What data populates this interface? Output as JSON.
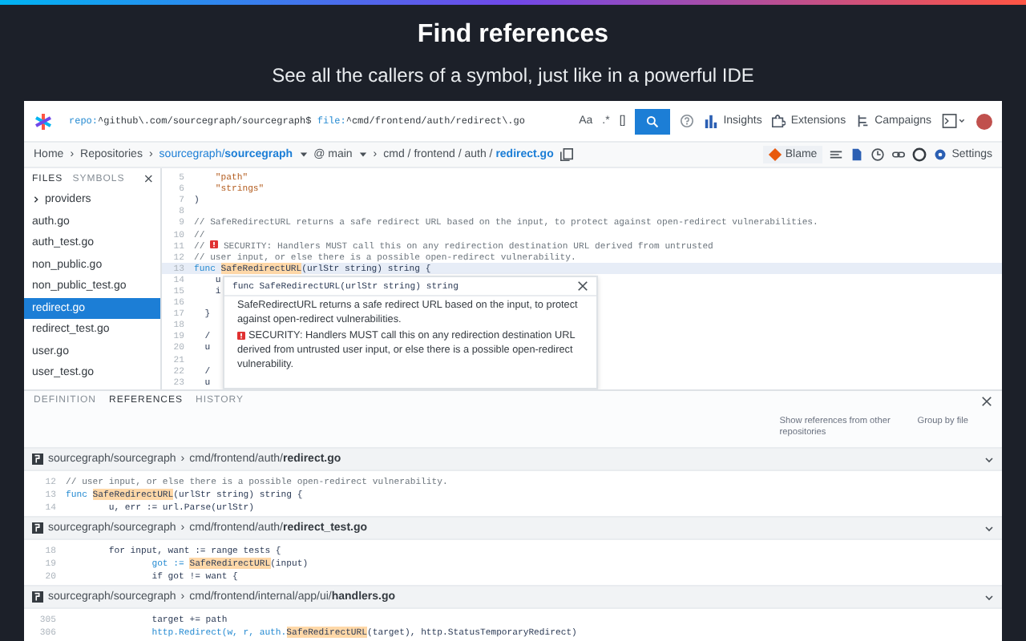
{
  "promo": {
    "title": "Find references",
    "subtitle": "See all the callers of a symbol, just like in a powerful IDE"
  },
  "toolbar": {
    "query": [
      {
        "kind": "filter",
        "text": "repo:"
      },
      {
        "kind": "value",
        "text": "^github\\.com/sourcegraph/sourcegraph$"
      },
      {
        "kind": "filter",
        "text": " file:"
      },
      {
        "kind": "value",
        "text": "^cmd/frontend/auth/redirect\\.go"
      }
    ],
    "toggles": [
      "Aa",
      ".*",
      "[]"
    ],
    "nav": [
      {
        "kind": "insights",
        "label": "Insights"
      },
      {
        "kind": "extensions",
        "label": "Extensions"
      },
      {
        "kind": "campaigns",
        "label": "Campaigns"
      }
    ]
  },
  "breadcrumb": {
    "separator": "›",
    "items": [
      "Home",
      "Repositories"
    ],
    "repo": "sourcegraph/**sourcegraph**",
    "revision": "@ main",
    "path": "cmd / frontend / auth / **redirect.go**"
  },
  "actions": {
    "blame": "Blame",
    "settings": "Settings"
  },
  "sidebar": {
    "tabs": [
      {
        "label": "FILES",
        "selected": true
      },
      {
        "label": "SYMBOLS",
        "selected": false
      }
    ],
    "items": [
      {
        "label": "providers",
        "kind": "folder",
        "selected": false
      },
      {
        "label": "auth.go",
        "kind": "file",
        "selected": false
      },
      {
        "label": "auth_test.go",
        "kind": "file",
        "selected": false
      },
      {
        "label": "non_public.go",
        "kind": "file",
        "selected": false
      },
      {
        "label": "non_public_test.go",
        "kind": "file",
        "selected": false
      },
      {
        "label": "redirect.go",
        "kind": "file",
        "selected": true
      },
      {
        "label": "redirect_test.go",
        "kind": "file",
        "selected": false
      },
      {
        "label": "user.go",
        "kind": "file",
        "selected": false
      },
      {
        "label": "user_test.go",
        "kind": "file",
        "selected": false
      }
    ]
  },
  "code": [
    {
      "n": "5",
      "kind": "string",
      "text": "    \"path\""
    },
    {
      "n": "6",
      "kind": "string",
      "text": "    \"strings\""
    },
    {
      "n": "7",
      "kind": "code",
      "text": ")"
    },
    {
      "n": "8",
      "kind": "code"
    },
    {
      "n": "9",
      "kind": "comment",
      "text": "// SafeRedirectURL returns a safe redirect URL based on the input, to protect against open-redirect vulnerabilities."
    },
    {
      "n": "10",
      "kind": "comment",
      "text": "//"
    },
    {
      "n": "11",
      "kind": "warning",
      "before": "// ",
      "after": "SECURITY: Handlers MUST call this on any redirection destination URL derived from untrusted"
    },
    {
      "n": "12",
      "kind": "comment",
      "text": "// user input, or else there is a possible open-redirect vulnerability."
    },
    {
      "n": "13",
      "kind": "match",
      "before": "func ",
      "match": "SafeRedirectURL",
      "after": "(urlStr string) string {"
    },
    {
      "n": "14",
      "kind": "code",
      "text": "    u"
    },
    {
      "n": "15",
      "kind": "code",
      "text": "    i"
    },
    {
      "n": "16",
      "kind": "code"
    },
    {
      "n": "17",
      "kind": "code",
      "text": "  }"
    },
    {
      "n": "18",
      "kind": "code"
    },
    {
      "n": "19",
      "kind": "code",
      "text": "  /"
    },
    {
      "n": "20",
      "kind": "code",
      "text": "  u"
    },
    {
      "n": "21",
      "kind": "code"
    },
    {
      "n": "22",
      "kind": "code",
      "text": "  /"
    },
    {
      "n": "23",
      "kind": "code",
      "text": "  u"
    }
  ],
  "hover": {
    "signature": "func SafeRedirectURL(urlStr string) string",
    "paragraphs": [
      {
        "kind": "text",
        "text": "SafeRedirectURL returns a safe redirect URL based on the input, to protect against open-redirect vulnerabilities."
      },
      {
        "kind": "warning",
        "text": "SECURITY: Handlers MUST call this on any redirection destination URL derived from untrusted user input, or else there is a possible open-redirect vulnerability."
      }
    ]
  },
  "panel": {
    "tabs": [
      {
        "label": "DEFINITION",
        "selected": false
      },
      {
        "label": "REFERENCES",
        "selected": true
      },
      {
        "label": "HISTORY",
        "selected": false
      }
    ],
    "links": [
      "Show references from other repositories",
      "Group by file"
    ],
    "groups": [
      {
        "repo": "sourcegraph/sourcegraph",
        "separator": "›",
        "path": "cmd/frontend/auth/**redirect.go**",
        "lines": [
          {
            "n": "12",
            "kind": "comment",
            "text": "// user input, or else there is a possible open-redirect vulnerability."
          },
          {
            "n": "13",
            "kind": "match",
            "before": "func ",
            "match": "SafeRedirectURL",
            "after": "(urlStr string) string {"
          },
          {
            "n": "14",
            "kind": "code",
            "text": "        u, err := url.Parse(urlStr)"
          }
        ]
      },
      {
        "repo": "sourcegraph/sourcegraph",
        "separator": "›",
        "path": "cmd/frontend/auth/**redirect_test.go**",
        "lines": [
          {
            "n": "18",
            "kind": "code",
            "text": "        for input, want := range tests {"
          },
          {
            "n": "19",
            "kind": "match",
            "before": "                got := ",
            "match": "SafeRedirectURL",
            "after": "(input)"
          },
          {
            "n": "20",
            "kind": "code",
            "text": "                if got != want {"
          }
        ]
      },
      {
        "repo": "sourcegraph/sourcegraph",
        "separator": "›",
        "path": "cmd/frontend/internal/app/ui/**handlers.go**",
        "lines": [
          {
            "n": "305",
            "kind": "code",
            "text": "                target += path"
          },
          {
            "n": "306",
            "kind": "match",
            "before": "                http.Redirect(w, r, auth.",
            "match": "SafeRedirectURL",
            "after": "(target), http.StatusTemporaryRedirect)"
          }
        ]
      }
    ]
  }
}
